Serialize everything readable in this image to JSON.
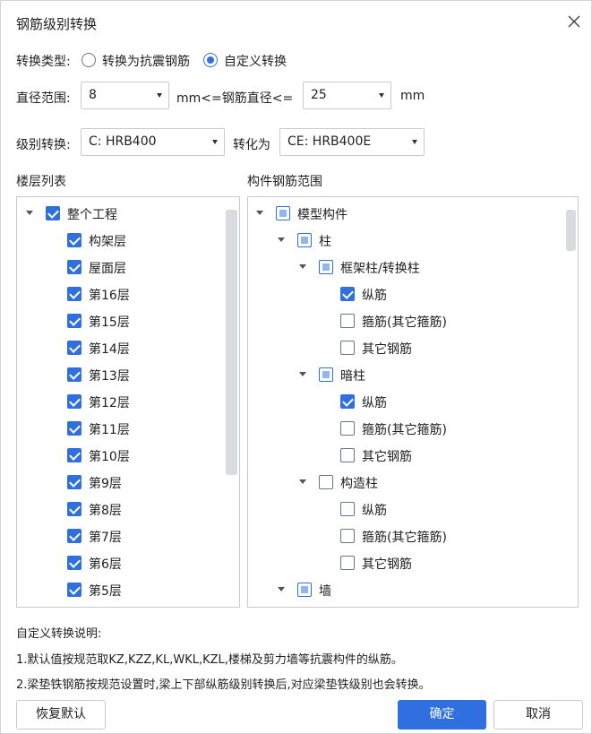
{
  "dialog": {
    "title": "钢筋级别转换"
  },
  "conversion_type": {
    "label": "转换类型:",
    "options": [
      {
        "label": "转换为抗震钢筋",
        "selected": false
      },
      {
        "label": "自定义转换",
        "selected": true
      }
    ]
  },
  "diameter": {
    "label": "直径范围:",
    "min": "8",
    "middle_text": "mm<=钢筋直径<=",
    "max": "25",
    "unit": "mm"
  },
  "grade": {
    "label": "级别转换:",
    "from": "C: HRB400",
    "to_label": "转化为",
    "to": "CE: HRB400E"
  },
  "floor_list": {
    "title": "楼层列表",
    "items": [
      {
        "label": "整个工程",
        "level": 0,
        "state": "checked",
        "expander": true
      },
      {
        "label": "构架层",
        "level": 1,
        "state": "checked",
        "expander": false
      },
      {
        "label": "屋面层",
        "level": 1,
        "state": "checked",
        "expander": false
      },
      {
        "label": "第16层",
        "level": 1,
        "state": "checked",
        "expander": false
      },
      {
        "label": "第15层",
        "level": 1,
        "state": "checked",
        "expander": false
      },
      {
        "label": "第14层",
        "level": 1,
        "state": "checked",
        "expander": false
      },
      {
        "label": "第13层",
        "level": 1,
        "state": "checked",
        "expander": false
      },
      {
        "label": "第12层",
        "level": 1,
        "state": "checked",
        "expander": false
      },
      {
        "label": "第11层",
        "level": 1,
        "state": "checked",
        "expander": false
      },
      {
        "label": "第10层",
        "level": 1,
        "state": "checked",
        "expander": false
      },
      {
        "label": "第9层",
        "level": 1,
        "state": "checked",
        "expander": false
      },
      {
        "label": "第8层",
        "level": 1,
        "state": "checked",
        "expander": false
      },
      {
        "label": "第7层",
        "level": 1,
        "state": "checked",
        "expander": false
      },
      {
        "label": "第6层",
        "level": 1,
        "state": "checked",
        "expander": false
      },
      {
        "label": "第5层",
        "level": 1,
        "state": "checked",
        "expander": false
      }
    ]
  },
  "component_range": {
    "title": "构件钢筋范围",
    "items": [
      {
        "label": "模型构件",
        "level": 0,
        "state": "partial",
        "expander": true
      },
      {
        "label": "柱",
        "level": 1,
        "state": "partial",
        "expander": true
      },
      {
        "label": "框架柱/转换柱",
        "level": 2,
        "state": "partial",
        "expander": true
      },
      {
        "label": "纵筋",
        "level": 3,
        "state": "checked",
        "expander": false
      },
      {
        "label": "箍筋(其它箍筋)",
        "level": 3,
        "state": "unchecked",
        "expander": false
      },
      {
        "label": "其它钢筋",
        "level": 3,
        "state": "unchecked",
        "expander": false
      },
      {
        "label": "暗柱",
        "level": 2,
        "state": "partial",
        "expander": true
      },
      {
        "label": "纵筋",
        "level": 3,
        "state": "checked",
        "expander": false
      },
      {
        "label": "箍筋(其它箍筋)",
        "level": 3,
        "state": "unchecked",
        "expander": false
      },
      {
        "label": "其它钢筋",
        "level": 3,
        "state": "unchecked",
        "expander": false
      },
      {
        "label": "构造柱",
        "level": 2,
        "state": "unchecked",
        "expander": true
      },
      {
        "label": "纵筋",
        "level": 3,
        "state": "unchecked",
        "expander": false
      },
      {
        "label": "箍筋(其它箍筋)",
        "level": 3,
        "state": "unchecked",
        "expander": false
      },
      {
        "label": "其它钢筋",
        "level": 3,
        "state": "unchecked",
        "expander": false
      },
      {
        "label": "墙",
        "level": 1,
        "state": "partial",
        "expander": true
      }
    ]
  },
  "notes": {
    "heading": "自定义转换说明:",
    "line1": "1.默认值按规范取KZ,KZZ,KL,WKL,KZL,楼梯及剪力墙等抗震构件的纵筋。",
    "line2": "2.梁垫铁钢筋按规范设置时,梁上下部纵筋级别转换后,对应梁垫铁级别也会转换。"
  },
  "buttons": {
    "restore": "恢复默认",
    "ok": "确定",
    "cancel": "取消"
  },
  "colors": {
    "accent": "#2f6fe0",
    "border": "#c7cbd1",
    "partial_fill": "#8fb6f0"
  }
}
